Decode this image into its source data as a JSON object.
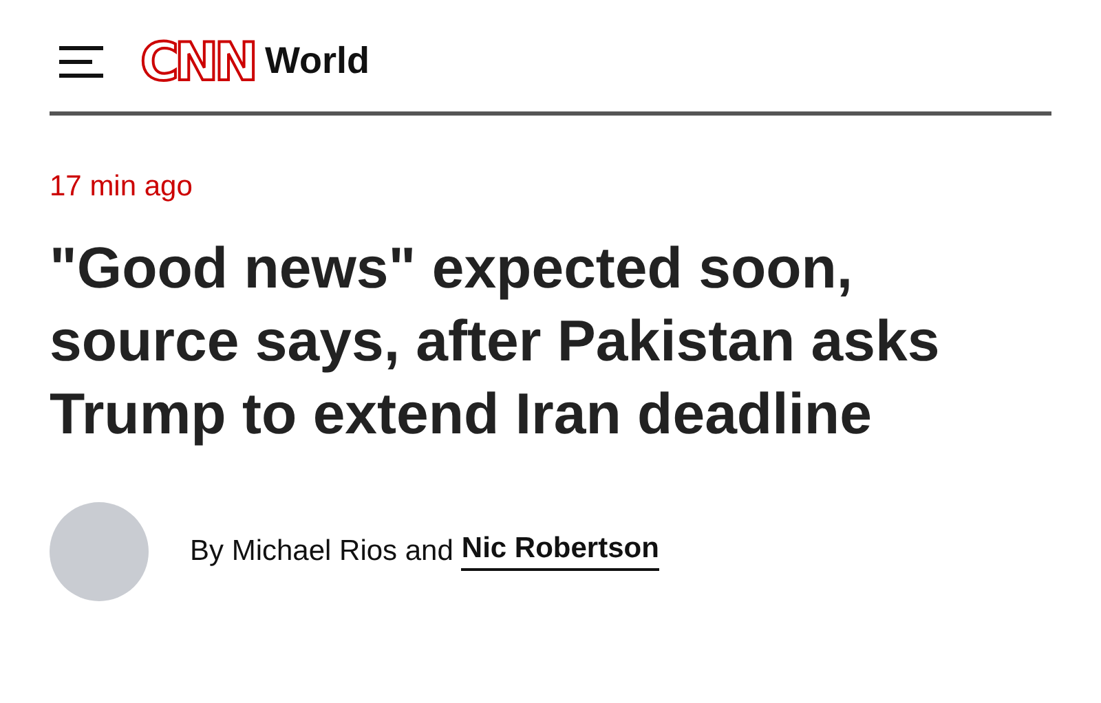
{
  "header": {
    "logo": "CNN",
    "section": "World"
  },
  "article": {
    "timestamp": "17 min ago",
    "headline": "\"Good news\" expected soon, source says, after Pakistan asks Trump to extend Iran deadline",
    "byline": {
      "prefix": "By Michael Rios and",
      "link": "Nic Robertson"
    }
  }
}
